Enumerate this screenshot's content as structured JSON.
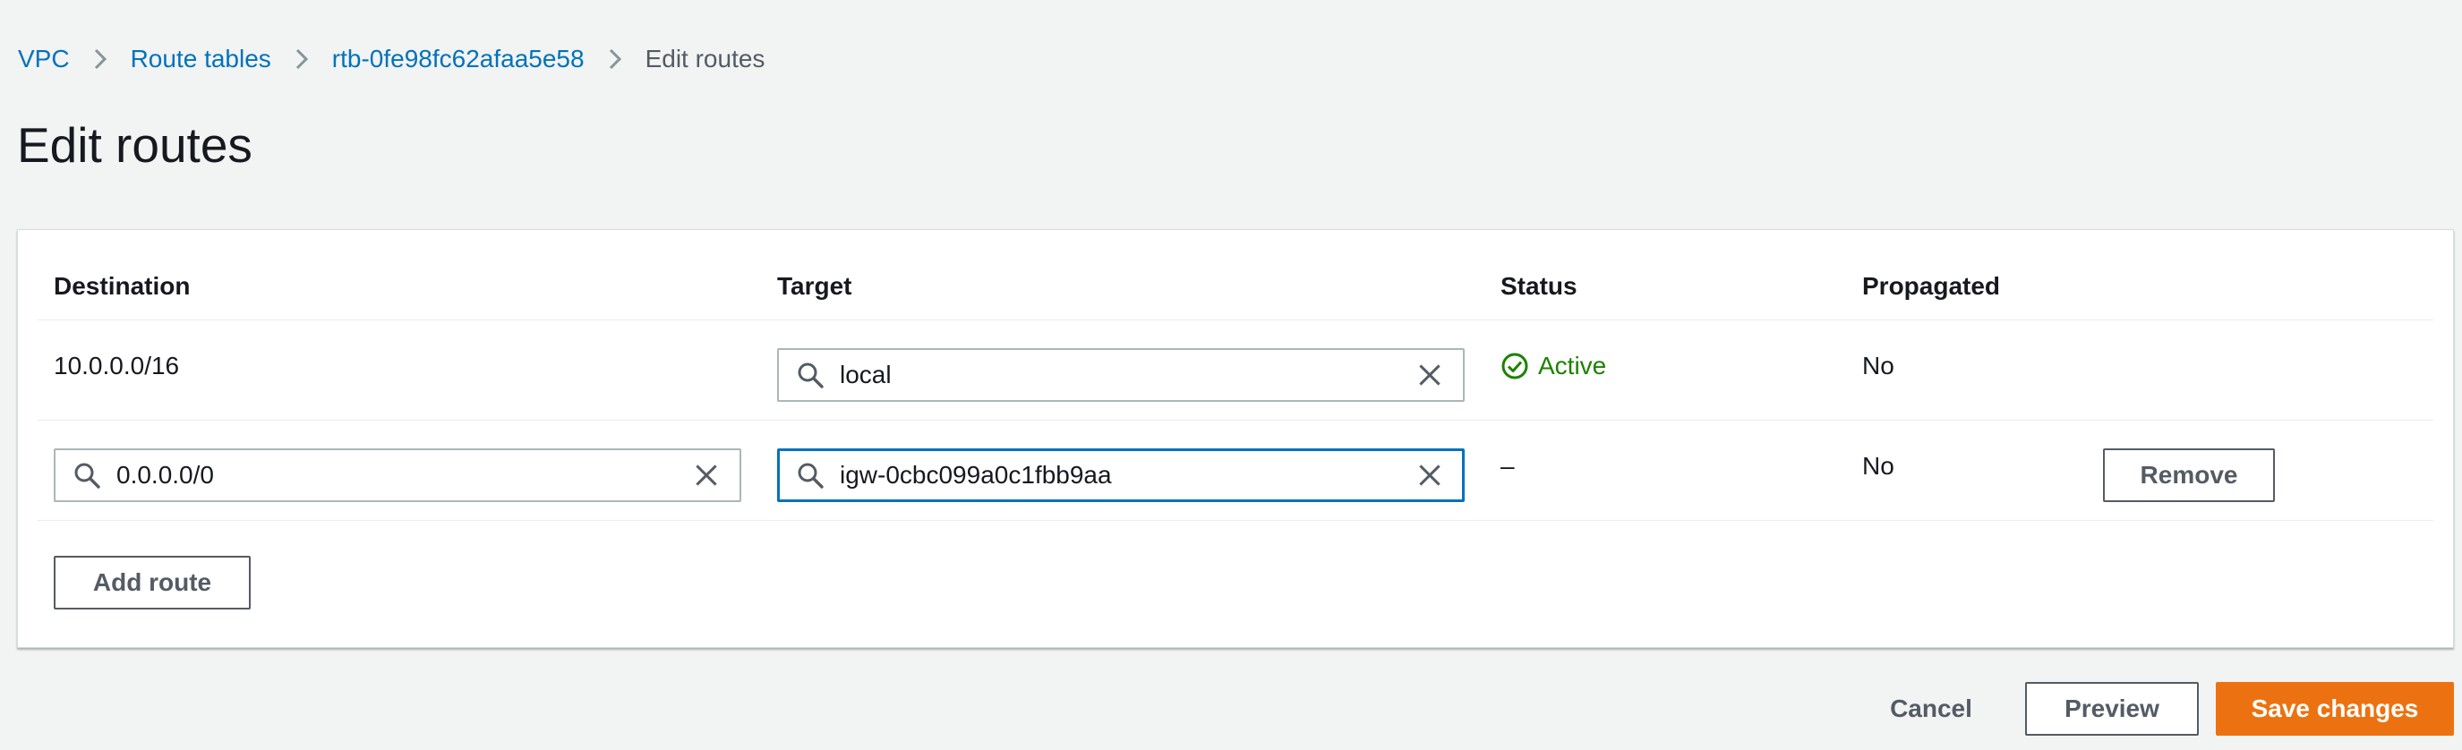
{
  "breadcrumb": {
    "items": [
      "VPC",
      "Route tables",
      "rtb-0fe98fc62afaa5e58"
    ],
    "current": "Edit routes"
  },
  "page_title": "Edit routes",
  "table": {
    "columns": {
      "destination": "Destination",
      "target": "Target",
      "status": "Status",
      "propagated": "Propagated"
    },
    "rows": [
      {
        "destination": "10.0.0.0/16",
        "target": "local",
        "status": "Active",
        "propagated": "No"
      },
      {
        "destination": "0.0.0.0/0",
        "target": "igw-0cbc099a0c1fbb9aa",
        "status": "–",
        "propagated": "No",
        "remove_label": "Remove"
      }
    ],
    "add_route_label": "Add route"
  },
  "footer": {
    "cancel_label": "Cancel",
    "preview_label": "Preview",
    "save_label": "Save changes"
  },
  "icons": {
    "search": "search-icon",
    "clear": "close-icon",
    "status_ok": "check-circle-icon",
    "breadcrumb_sep": "chevron-right-icon"
  },
  "colors": {
    "link": "#0073bb",
    "primary": "#ec7211",
    "success": "#1d8102",
    "focus": "#0073bb",
    "background": "#f2f3f3"
  }
}
